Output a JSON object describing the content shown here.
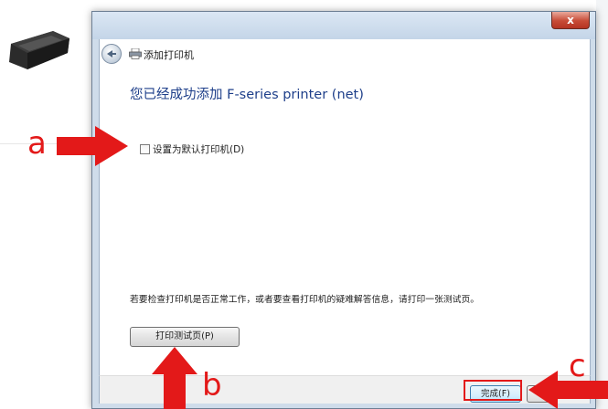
{
  "window": {
    "close_label": "x"
  },
  "nav": {
    "title": "添加打印机"
  },
  "main": {
    "heading": "您已经成功添加 F-series printer (net)",
    "default_checkbox_label": "设置为默认打印机(D)",
    "default_checked": false,
    "info_text": "若要检查打印机是否正常工作，或者要查看打印机的疑难解答信息，请打印一张测试页。",
    "test_page_button": "打印测试页(P)"
  },
  "footer": {
    "finish_button": "完成(F)"
  },
  "annotations": {
    "a": "a",
    "b": "b",
    "c": "c",
    "color": "#e31919"
  }
}
